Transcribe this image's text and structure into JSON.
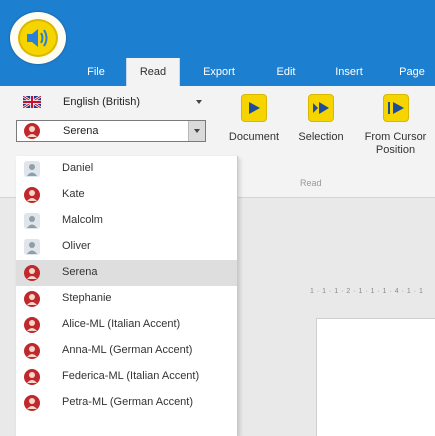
{
  "menubar": {
    "items": [
      {
        "label": "File"
      },
      {
        "label": "Read"
      },
      {
        "label": "Export"
      },
      {
        "label": "Edit"
      },
      {
        "label": "Insert"
      },
      {
        "label": "Page"
      }
    ],
    "active": "Read"
  },
  "ribbon": {
    "language": {
      "value": "English (British)",
      "icon": "uk-flag-icon"
    },
    "voice": {
      "value": "Serena",
      "icon": "female-voice-icon"
    },
    "buttons": [
      {
        "label": "Document"
      },
      {
        "label": "Selection"
      },
      {
        "label": "From Cursor\nPosition"
      }
    ],
    "group_label": "Read"
  },
  "ruler_text": "1 · 1 · 1 · 2 · 1 · 1 · 1 · 4 · 1 · 1",
  "voice_dropdown": {
    "items": [
      {
        "name": "Daniel",
        "icon": "male-voice-icon"
      },
      {
        "name": "Kate",
        "icon": "female-voice-icon"
      },
      {
        "name": "Malcolm",
        "icon": "male-voice-icon"
      },
      {
        "name": "Oliver",
        "icon": "male-voice-icon"
      },
      {
        "name": "Serena",
        "icon": "female-voice-icon",
        "selected": true
      },
      {
        "name": "Stephanie",
        "icon": "female-voice-icon"
      },
      {
        "name": "Alice-ML (Italian Accent)",
        "icon": "female-voice-icon"
      },
      {
        "name": "Anna-ML (German Accent)",
        "icon": "female-voice-icon"
      },
      {
        "name": "Federica-ML (Italian Accent)",
        "icon": "female-voice-icon"
      },
      {
        "name": "Petra-ML (German Accent)",
        "icon": "female-voice-icon"
      }
    ]
  },
  "colors": {
    "titlebar": "#1d7fd0",
    "accent_yellow": "#f6d400",
    "female_icon": "#c0282d",
    "male_icon": "#9aa9b5"
  }
}
